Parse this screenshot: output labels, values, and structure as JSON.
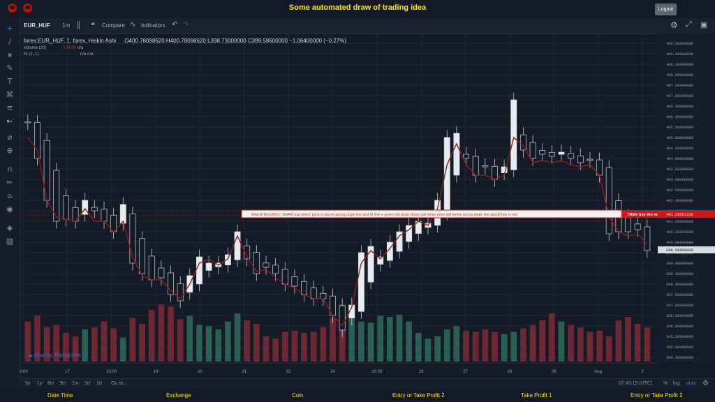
{
  "app": {
    "title": "Some automated draw of trading idea",
    "logout_label": "Logout"
  },
  "toolbar": {
    "symbol": "EUR_HUF",
    "interval": "1m",
    "compare_label": "Compare",
    "indicators_label": "Indicators"
  },
  "legend": {
    "main": "forex:EUR_HUF, 1, forex, Heikin Ashi",
    "open": "O400.78098620",
    "high": "H400.78098620",
    "low": "L398.73000000",
    "close": "C399.58600000",
    "change": "−1.06400000 (−0.27%)",
    "volume_label": "Volume (20)",
    "volume_value": "3.987K",
    "volume_na": "n/a",
    "ai_label": "AI (1, 1)",
    "ai_na1": "n/a",
    "ai_na2": "n/a"
  },
  "annotation": {
    "main_text": "Wait till flip ENDS  !   DRAW just when:  price is above strong angle line and AI line is green           OR           draw shorts just when price still below strong angle line and AI line is red",
    "red_text": "THEN See the magic!!"
  },
  "price_axis": {
    "ticks": [
      "409.50000000",
      "409.00000000",
      "408.50000000",
      "408.00000000",
      "407.50000000",
      "407.00000000",
      "406.50000000",
      "406.00000000",
      "405.50000000",
      "405.00000000",
      "404.50000000",
      "404.00000000",
      "403.50000000",
      "403.00000000",
      "402.50000000",
      "402.00000000",
      "401.50000000",
      "401.00000000",
      "400.50000000",
      "400.00000000",
      "399.50000000",
      "399.00000000",
      "398.50000000",
      "398.00000000",
      "397.50000000",
      "397.00000000",
      "396.50000000",
      "396.00000000",
      "395.50000000",
      "395.00000000",
      "394.50000000"
    ],
    "ai_marker": "401.29561316",
    "close_marker": "399.58600000"
  },
  "time_axis": {
    "labels": [
      ":6:00",
      "17",
      "10:00",
      "19",
      "20",
      "21",
      "22",
      "24",
      "10:00",
      "26",
      "27",
      "28",
      "29",
      "Aug",
      "2"
    ]
  },
  "bottom": {
    "ranges": [
      "5y",
      "1y",
      "6m",
      "3m",
      "1m",
      "5d",
      "1d"
    ],
    "goto": "Go to...",
    "time": "07:45:19 (UTC)",
    "percent": "%",
    "log": "log",
    "auto": "auto"
  },
  "footer": {
    "labels": [
      "Date Time",
      "Exchange",
      "Coin",
      "Entry or Take Profit 2",
      "Take Profit 1",
      "Entry or Take Profit 2"
    ]
  },
  "watermark": "Chart by TradingView",
  "chart_data": {
    "type": "candlestick",
    "symbol": "forex:EUR_HUF",
    "ylim": [
      394.3,
      409.7
    ],
    "x": [
      "16 06:00",
      "17",
      "17 10:00",
      "19",
      "20",
      "21",
      "22",
      "24",
      "24 10:00",
      "26",
      "27",
      "28",
      "29",
      "Aug",
      "2"
    ],
    "close": [
      405.7,
      404.0,
      402.0,
      401.0,
      401.1,
      401.0,
      402.0,
      401.5,
      401.0,
      400.5,
      401.8,
      399.0,
      398.5,
      398.2,
      398.3,
      397.5,
      397.2,
      398.4,
      399.3,
      399.0,
      399.0,
      399.4,
      400.5,
      399.2,
      398.5,
      398.8,
      398.5,
      398.0,
      397.9,
      397.5,
      397.3,
      397.3,
      396.5,
      395.8,
      397.0,
      399.5,
      399.8,
      399.3,
      400.0,
      400.5,
      400.8,
      401.0,
      400.9,
      402.0,
      405.0,
      405.2,
      404.0,
      403.2,
      403.6,
      403.0,
      403.6,
      406.8,
      404.4,
      404.0,
      404.2,
      404.1,
      404.3,
      404.0,
      403.8,
      403.9,
      403.2,
      400.4,
      400.5,
      400.5,
      400.6,
      399.6
    ],
    "ai_line": [
      405.0,
      404.4,
      402.0,
      401.2,
      401.1,
      401.0,
      401.6,
      401.0,
      401.0,
      400.5,
      401.0,
      399.3,
      398.4,
      398.2,
      398.2,
      397.7,
      397.3,
      398.0,
      399.0,
      399.2,
      398.9,
      399.2,
      400.3,
      399.3,
      398.6,
      398.7,
      398.3,
      398.0,
      397.8,
      397.5,
      397.3,
      397.3,
      396.5,
      396.0,
      396.9,
      399.0,
      399.6,
      399.2,
      399.7,
      400.3,
      400.6,
      401.0,
      400.8,
      401.6,
      403.7,
      404.7,
      403.7,
      403.2,
      403.2,
      403.0,
      403.2,
      405.0,
      404.6,
      403.8,
      403.9,
      403.8,
      403.9,
      403.7,
      403.6,
      403.7,
      403.2,
      401.2,
      400.5,
      400.3,
      400.4,
      399.9
    ],
    "volume": [
      3.5,
      4.0,
      3.0,
      3.2,
      2.5,
      2.2,
      2.8,
      3.0,
      3.5,
      2.9,
      2.1,
      3.8,
      3.3,
      4.5,
      5.0,
      4.8,
      3.7,
      4.0,
      3.2,
      3.1,
      2.8,
      3.5,
      4.2,
      3.6,
      3.3,
      2.2,
      2.0,
      2.6,
      2.7,
      2.5,
      2.6,
      3.0,
      3.8,
      5.0,
      4.6,
      3.5,
      3.4,
      4.0,
      3.9,
      4.1,
      3.5,
      2.5,
      2.0,
      2.2,
      2.8,
      3.1,
      2.7,
      2.6,
      2.8,
      2.6,
      2.4,
      2.6,
      2.9,
      3.2,
      3.6,
      4.2,
      3.5,
      3.2,
      3.0,
      2.6,
      2.7,
      2.2,
      3.6,
      3.9,
      3.3,
      3.0
    ]
  }
}
